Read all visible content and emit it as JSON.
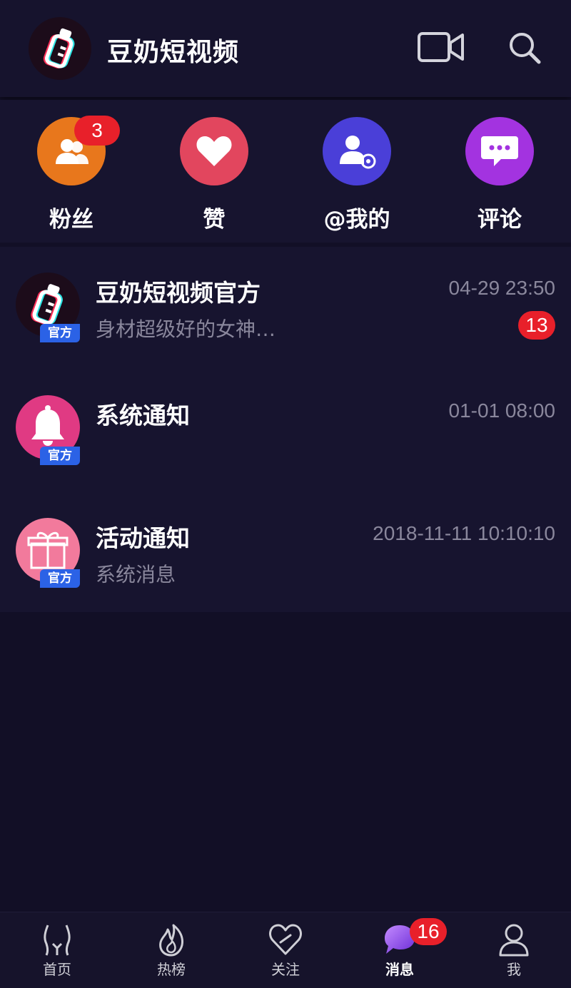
{
  "header": {
    "title": "豆奶短视频",
    "icons": [
      "bottle-logo-icon",
      "video-camera-icon",
      "search-icon"
    ]
  },
  "shortcuts": [
    {
      "label": "粉丝",
      "icon": "fans-icon",
      "color": "#e8771c",
      "badge": "3"
    },
    {
      "label": "赞",
      "icon": "heart-icon",
      "color": "#e2465e"
    },
    {
      "label": "@我的",
      "icon": "mention-icon",
      "color": "#4a3fd8"
    },
    {
      "label": "评论",
      "icon": "comment-icon",
      "color": "#a333e0"
    }
  ],
  "messages": [
    {
      "title": "豆奶短视频官方",
      "subtitle": "身材超级好的女神…",
      "time": "04-29 23:50",
      "badge": "13",
      "tag": "官方",
      "icon": "bottle-logo-icon"
    },
    {
      "title": "系统通知",
      "subtitle": "",
      "time": "01-01 08:00",
      "tag": "官方",
      "icon": "bell-icon",
      "color": "#e03a83"
    },
    {
      "title": "活动通知",
      "subtitle": "系统消息",
      "time": "2018-11-11 10:10:10",
      "tag": "官方",
      "icon": "gift-icon",
      "color": "#f27a9c"
    }
  ],
  "tabbar": {
    "tabs": [
      {
        "label": "首页",
        "icon": "home-icon"
      },
      {
        "label": "热榜",
        "icon": "flame-icon"
      },
      {
        "label": "关注",
        "icon": "heart-outline-icon"
      },
      {
        "label": "消息",
        "icon": "message-bubble-icon",
        "badge": "16",
        "active": true
      },
      {
        "label": "我",
        "icon": "person-icon"
      }
    ]
  },
  "colors": {
    "background": "#120f26",
    "badge": "#e8202a",
    "official_tag": "#2b62e6"
  }
}
